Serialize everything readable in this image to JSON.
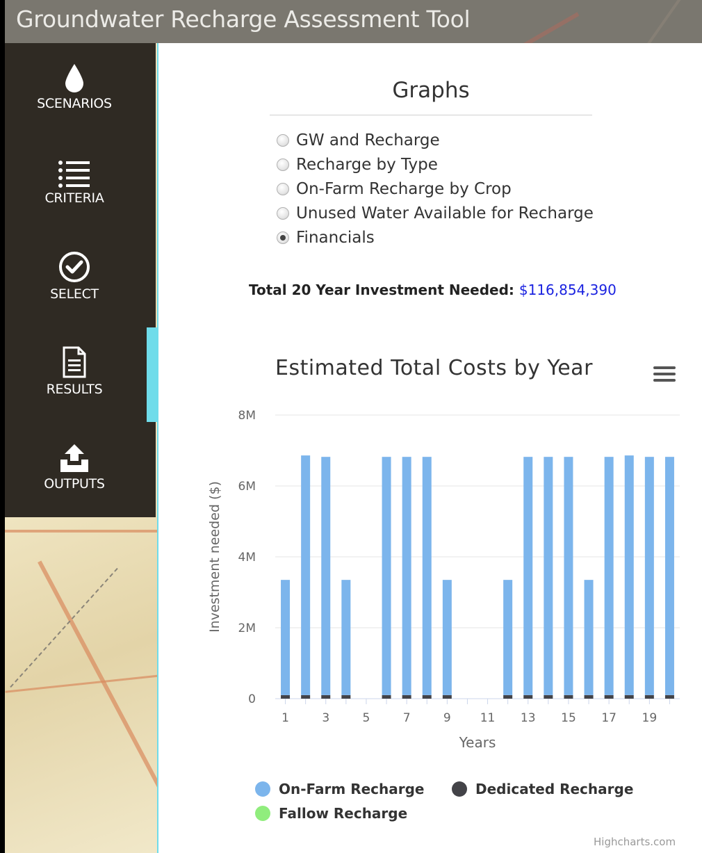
{
  "app": {
    "title": "Groundwater Recharge Assessment Tool"
  },
  "sidebar": {
    "items": [
      {
        "label": "SCENARIOS",
        "icon": "water-drop-icon"
      },
      {
        "label": "CRITERIA",
        "icon": "list-icon"
      },
      {
        "label": "SELECT",
        "icon": "check-circle-icon"
      },
      {
        "label": "RESULTS",
        "icon": "document-icon",
        "active": true
      },
      {
        "label": "OUTPUTS",
        "icon": "upload-tray-icon"
      }
    ]
  },
  "graphs": {
    "heading": "Graphs",
    "options": [
      {
        "label": "GW and Recharge",
        "checked": false
      },
      {
        "label": "Recharge by Type",
        "checked": false
      },
      {
        "label": "On-Farm Recharge by Crop",
        "checked": false
      },
      {
        "label": "Unused Water Available for Recharge",
        "checked": false
      },
      {
        "label": "Financials",
        "checked": true
      }
    ]
  },
  "investment": {
    "label": "Total 20 Year Investment Needed:",
    "value": "$116,854,390"
  },
  "chart_data": {
    "type": "bar",
    "stacked": true,
    "title": "Estimated Total Costs by Year",
    "xlabel": "Years",
    "ylabel": "Investment needed ($)",
    "categories": [
      1,
      2,
      3,
      4,
      5,
      6,
      7,
      8,
      9,
      10,
      11,
      12,
      13,
      14,
      15,
      16,
      17,
      18,
      19,
      20
    ],
    "x_tick_labels": [
      "1",
      "3",
      "5",
      "7",
      "9",
      "11",
      "13",
      "15",
      "17",
      "19"
    ],
    "y_tick_labels": [
      "0",
      "2M",
      "4M",
      "6M",
      "8M"
    ],
    "ylim": [
      0,
      8000000
    ],
    "grid": true,
    "legend_position": "bottom",
    "series": [
      {
        "name": "On-Farm Recharge",
        "color": "#7cb5ec",
        "values": [
          3250000,
          6760000,
          6720000,
          3250000,
          0,
          6720000,
          6720000,
          6720000,
          3250000,
          0,
          0,
          3250000,
          6720000,
          6720000,
          6720000,
          3250000,
          6720000,
          6760000,
          6720000,
          6720000
        ]
      },
      {
        "name": "Dedicated Recharge",
        "color": "#434348",
        "values": [
          100000,
          100000,
          100000,
          100000,
          0,
          100000,
          100000,
          100000,
          100000,
          0,
          0,
          100000,
          100000,
          100000,
          100000,
          100000,
          100000,
          100000,
          100000,
          100000
        ]
      },
      {
        "name": "Fallow Recharge",
        "color": "#90ed7d",
        "values": [
          0,
          0,
          0,
          0,
          0,
          0,
          0,
          0,
          0,
          0,
          0,
          0,
          0,
          0,
          0,
          0,
          0,
          0,
          0,
          0
        ]
      }
    ]
  },
  "credits": "Highcharts.com"
}
